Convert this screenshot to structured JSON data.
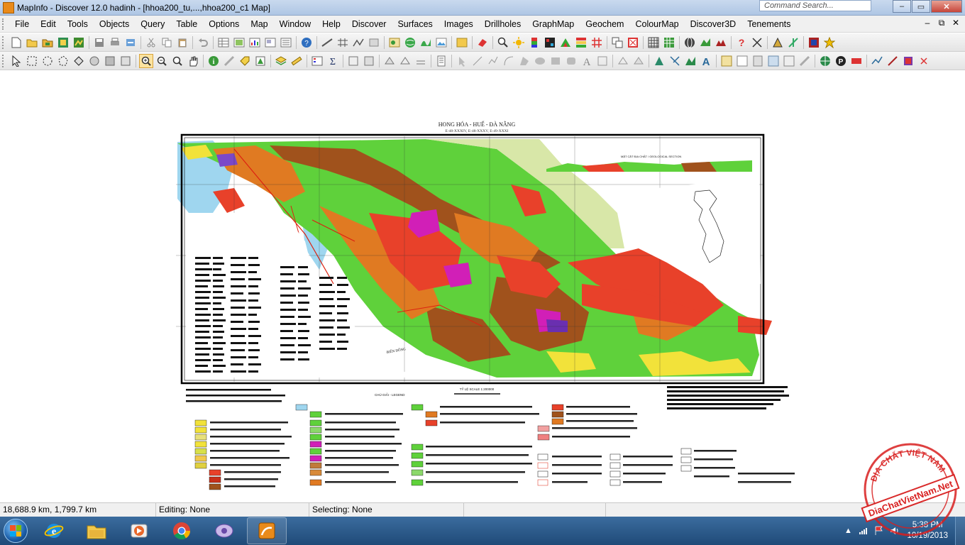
{
  "window": {
    "title": "MapInfo - Discover 12.0     hadinh - [hhoa200_tu,...,hhoa200_c1 Map]",
    "command_search_placeholder": "Command Search...",
    "buttons": {
      "minimize": "–",
      "maximize": "▭",
      "close": "✕"
    }
  },
  "menubar": {
    "items": [
      "File",
      "Edit",
      "Tools",
      "Objects",
      "Query",
      "Table",
      "Options",
      "Map",
      "Window",
      "Help",
      "Discover",
      "Surfaces",
      "Images",
      "Drillholes",
      "GraphMap",
      "Geochem",
      "ColourMap",
      "Discover3D",
      "Tenements"
    ],
    "mdi": {
      "minimize": "–",
      "restore": "⧉",
      "close": "✕"
    }
  },
  "map": {
    "title": "HONG HÓA - HUẾ - ĐÀ NẴNG",
    "subtitle": "E-48-XXXIV, E-48-XXXV, E-49-XXXI",
    "section_label": "MẶT CẮT ĐỊA CHẤT / GEOLOGICAL SECTION",
    "legend_label": "CHÚ GIẢI - LEGEND",
    "scale_label": "TỶ LỆ SCALE 1:200000",
    "sea_label": "BIỂN ĐÔNG"
  },
  "statusbar": {
    "coordinates": "18,688.9 km, 1,799.7 km",
    "editing": "Editing: None",
    "selecting": "Selecting: None"
  },
  "taskbar": {
    "clock_time": "5:38 PM",
    "clock_date": "10/19/2013",
    "apps": [
      "internet-explorer",
      "file-explorer",
      "media-player",
      "chrome",
      "image-viewer",
      "mapinfo"
    ]
  },
  "watermark": {
    "text": "DiaChatVietNam.Net",
    "arc_text": "ĐỊA CHẤT VIỆT NAM"
  },
  "colors": {
    "map_green": "#5fd13b",
    "map_orange": "#e07a22",
    "map_red": "#e8412a",
    "map_magenta": "#d11fb7",
    "map_yellow": "#f2e23a",
    "map_brown": "#a0521c",
    "map_cyan": "#9fd6ef",
    "watermark_red": "#d81f1f"
  }
}
